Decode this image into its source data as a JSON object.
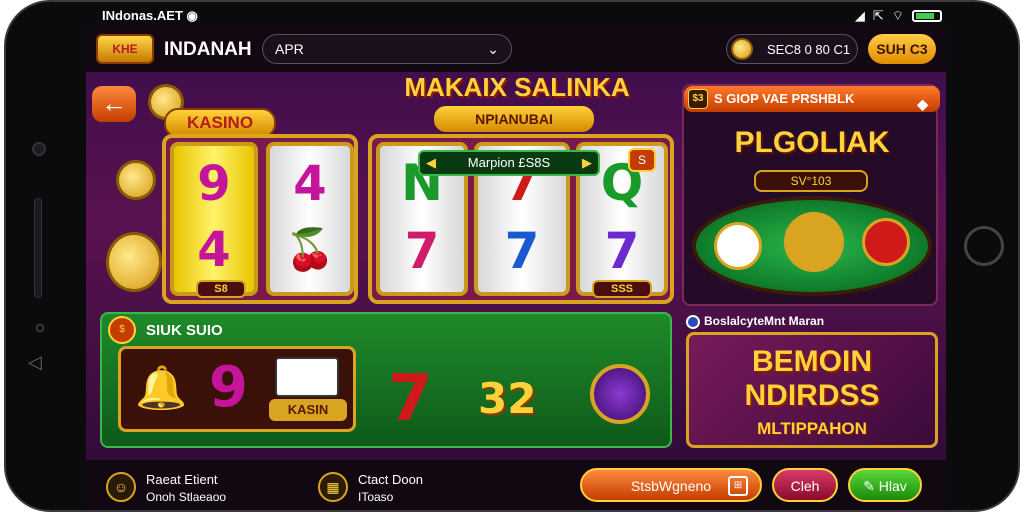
{
  "status": {
    "carrier": "INdonas.AET",
    "left_icon": "record-dot-icon",
    "icons": [
      "signal-icon",
      "location-icon",
      "wifi-icon",
      "battery-icon"
    ]
  },
  "header": {
    "app_name": "INDANAH",
    "logo_text": "KHE",
    "search_value": "APR",
    "balance": "SEC8 0 80 C1",
    "top_button": "SUH C3"
  },
  "promo": {
    "title": "MAKAIX SALINKA",
    "subtitle": "NPIANUBAI"
  },
  "slot": {
    "badge": "KASINO",
    "left_reels": [
      [
        "9",
        "4"
      ],
      [
        "4",
        "🍒"
      ]
    ],
    "right_reels": [
      [
        "N",
        "7"
      ],
      [
        "7",
        "7"
      ],
      [
        "Q",
        "7"
      ]
    ],
    "left_tag": "S8",
    "right_tag": "SSS"
  },
  "right_panel": {
    "header": "S GIOP VAE PRSHBLK",
    "title": "PLGOLIAK",
    "sub": "SV°103"
  },
  "mid_label": "BoslalcyteMnt Maran",
  "bonus": {
    "line1": "BEMOIN",
    "line2": "NDIRDSS",
    "line3": "MLTIPPAHON"
  },
  "green_panel": {
    "title": "SIUK SUIO",
    "symbol_bell": "🔔",
    "symbol_nine": "9",
    "cards_label": "KASIN",
    "seven": "7",
    "score": "32",
    "bar_text": "Marpion £S8S",
    "small_btn": "S"
  },
  "bottom": {
    "item1": {
      "t1": "Raeat Etient",
      "t2": "Onoh Stlaeaoo"
    },
    "item2": {
      "t1": "Ctact Doon",
      "t2": "IToaso"
    },
    "orange_btn": "StsbWgneno",
    "red_btn": "Cleh",
    "green_btn": "Hlav"
  },
  "colors": {
    "accent_gold": "#ffd23a",
    "panel_green": "#1f8a2a",
    "bg_purple": "#3a0c4a",
    "orange": "#ff7a2a"
  }
}
